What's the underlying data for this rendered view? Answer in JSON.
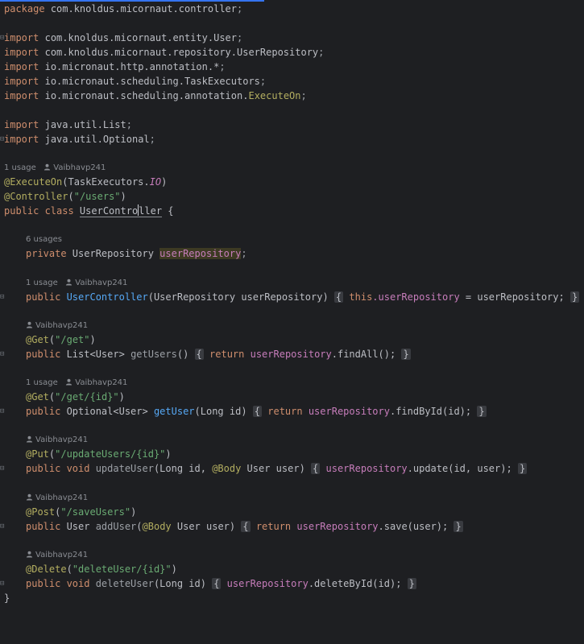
{
  "code": {
    "package_kw": "package",
    "package_name": "com.knoldus.micornaut.controller",
    "semi": ";",
    "import_kw": "import",
    "imports": [
      "com.knoldus.micornaut.entity.User",
      "com.knoldus.micornaut.repository.UserRepository",
      "io.micronaut.http.annotation.*",
      "io.micronaut.scheduling.TaskExecutors",
      "io.micronaut.scheduling.annotation.",
      "java.util.List",
      "java.util.Optional"
    ],
    "import_execute_on": "ExecuteOn",
    "hints": {
      "one_usage": "1 usage",
      "six_usages": "6 usages",
      "author": "Vaibhavp241"
    },
    "class_decl": {
      "ann_execute_on": "@ExecuteOn",
      "task_executors": "(TaskExecutors.",
      "io": "IO",
      "close_paren": ")",
      "ann_controller": "@Controller",
      "controller_path": "\"/users\"",
      "public_class": "public class ",
      "class_name_a": "UserContro",
      "class_name_b": "ller",
      "open_brace": " {"
    },
    "field": {
      "private_kw": "private ",
      "type": "UserRepository ",
      "name": "userRepository",
      "semi": ";"
    },
    "constructor": {
      "public_kw": "public ",
      "name": "UserController",
      "params": "(UserRepository userRepository) ",
      "this_kw": "this",
      "dot_field": ".userRepository",
      "assign": " = userRepository; "
    },
    "methods": [
      {
        "annotation": "@Get",
        "path": "\"/get\"",
        "modifiers": "public ",
        "ret": "List<User> ",
        "name": "getUsers",
        "params": "() ",
        "body_kw": "return ",
        "body_field": "userRepository",
        "body_rest": ".findAll(); "
      },
      {
        "annotation": "@Get",
        "path": "\"/get/{id}\"",
        "modifiers": "public ",
        "ret": "Optional<User> ",
        "name": "getUser",
        "params": "(Long id) ",
        "body_kw": "return ",
        "body_field": "userRepository",
        "body_rest": ".findById(id); "
      },
      {
        "annotation": "@Put",
        "path": "\"/updateUsers/{id}\"",
        "modifiers": "public void ",
        "ret": "",
        "name": "updateUser",
        "params_a": "(Long id, ",
        "params_ann": "@Body",
        "params_b": " User user) ",
        "body_field": "userRepository",
        "body_rest": ".update(id, user); "
      },
      {
        "annotation": "@Post",
        "path": "\"/saveUsers\"",
        "modifiers": "public ",
        "ret": "User ",
        "name": "addUser",
        "params_a": "(",
        "params_ann": "@Body",
        "params_b": " User user) ",
        "body_kw": "return ",
        "body_field": "userRepository",
        "body_rest": ".save(user); "
      },
      {
        "annotation": "@Delete",
        "path": "\"deleteUser/{id}\"",
        "modifiers": "public void ",
        "ret": "",
        "name": "deleteUser",
        "params": "(Long id) ",
        "body_field": "userRepository",
        "body_rest": ".deleteById(id); "
      }
    ],
    "closing_brace": "}",
    "lbrace": "{",
    "rbrace": "}",
    "lparen": "(",
    "rparen": ")"
  },
  "colors": {
    "background": "#1e1f22",
    "keyword": "#cf8e6d",
    "string": "#6aab73",
    "annotation": "#b3ae60",
    "field": "#c77dbb",
    "method": "#56a8f5",
    "text": "#bcbec4"
  },
  "icons": [
    "user-icon",
    "fold-marker-icon"
  ]
}
